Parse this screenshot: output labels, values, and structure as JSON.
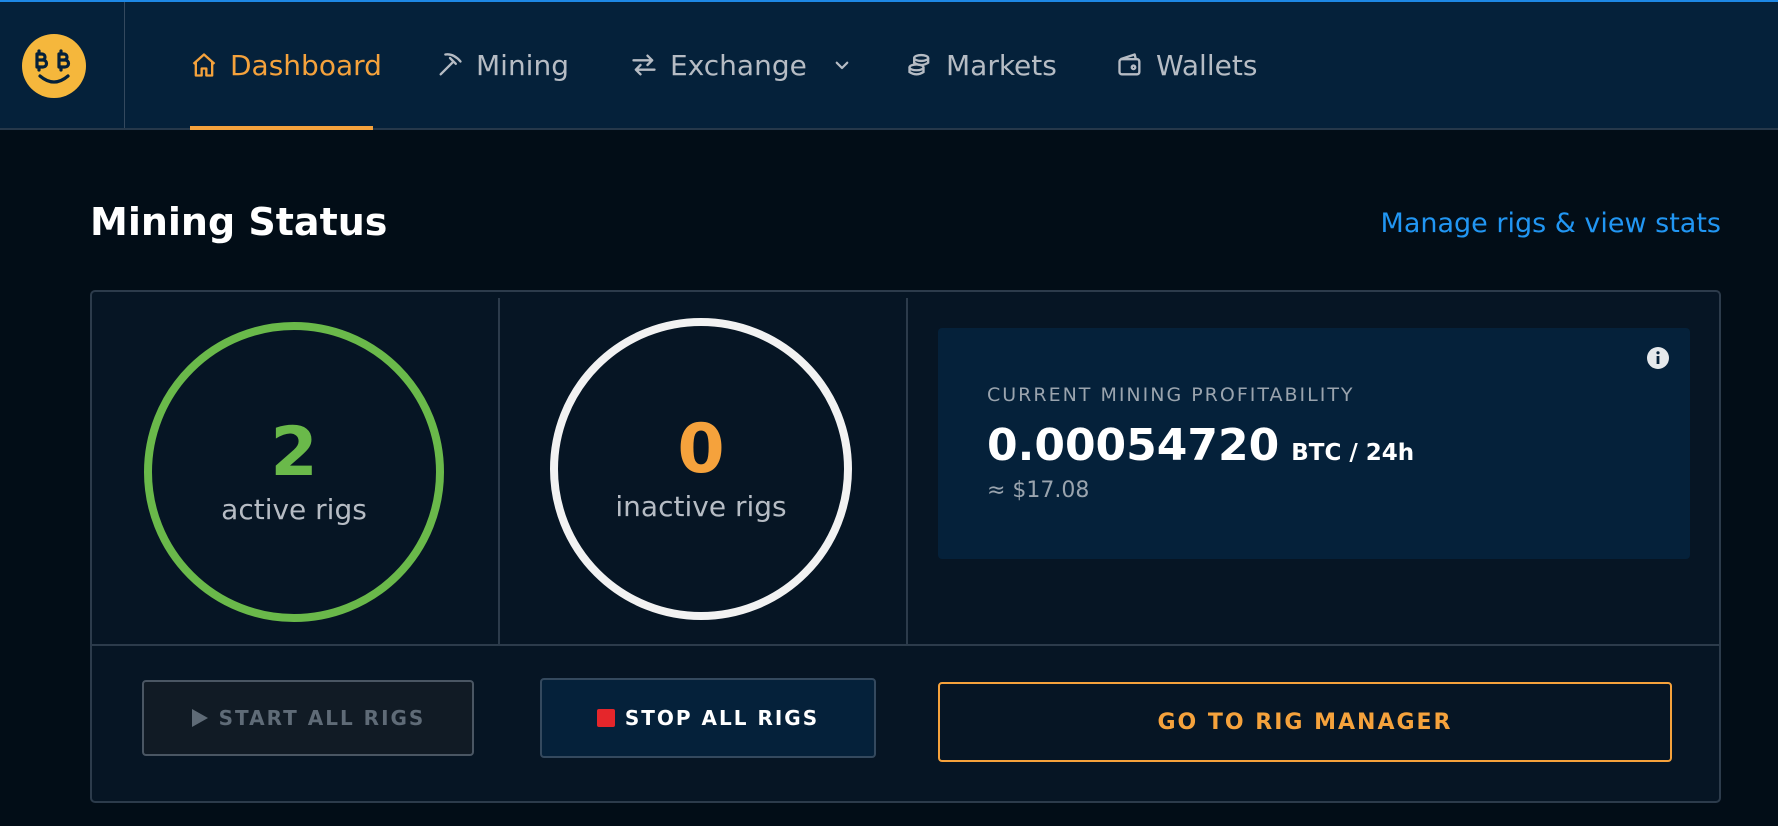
{
  "colors": {
    "accent": "#f5a23c",
    "link": "#2196f3",
    "active_green": "#6ab94a",
    "inactive_orange": "#f5a23c",
    "danger": "#e5262b",
    "background": "#020d17",
    "navbar": "#05213a"
  },
  "nav": {
    "logo_icon": "bitcoin-smiley-logo",
    "items": [
      {
        "label": "Dashboard",
        "icon": "home-icon",
        "active": true
      },
      {
        "label": "Mining",
        "icon": "pickaxe-icon",
        "active": false
      },
      {
        "label": "Exchange",
        "icon": "swap-arrows-icon",
        "active": false,
        "dropdown": true
      },
      {
        "label": "Markets",
        "icon": "coins-stack-icon",
        "active": false
      },
      {
        "label": "Wallets",
        "icon": "wallet-icon",
        "active": false
      }
    ]
  },
  "mining_status": {
    "title": "Mining Status",
    "manage_link": "Manage rigs & view stats",
    "active": {
      "count": "2",
      "label": "active rigs"
    },
    "inactive": {
      "count": "0",
      "label": "inactive rigs"
    },
    "profitability": {
      "label": "CURRENT MINING PROFITABILITY",
      "value": "0.00054720",
      "unit": "BTC / 24h",
      "usd": "≈ $17.08"
    },
    "buttons": {
      "start": "START ALL RIGS",
      "stop": "STOP ALL RIGS",
      "rig_manager": "GO TO RIG MANAGER"
    }
  }
}
